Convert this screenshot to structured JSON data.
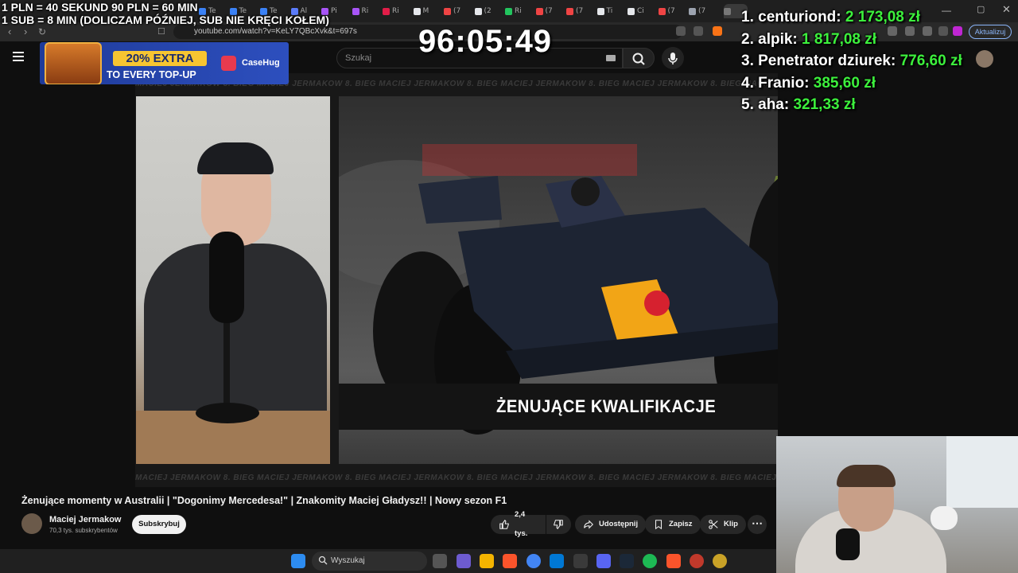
{
  "stream": {
    "donation_line1": "1 PLN = 40 SEKUND 90 PLN = 60 MIN",
    "donation_line2": "1 SUB = 8 MIN (DOLICZAM PÓŹNIEJ, SUB NIE KRĘCI KOŁEM)",
    "timer": "96:05:49",
    "leaderboard": [
      {
        "rank_name": "1. centuriond:",
        "amount": "2 173,08 zł"
      },
      {
        "rank_name": "2. alpik:",
        "amount": "1 817,08 zł"
      },
      {
        "rank_name": "3. Penetrator dziurek:",
        "amount": "776,60 zł"
      },
      {
        "rank_name": "4. Franio:",
        "amount": "385,60 zł"
      },
      {
        "rank_name": "5. aha:",
        "amount": "321,33 zł"
      }
    ]
  },
  "browser": {
    "url": "youtube.com/watch?v=KeLY7QBcXvk&t=697s",
    "update_button": "Aktualizuj",
    "tabs": [
      {
        "label": "Te",
        "color": "#3b82f6"
      },
      {
        "label": "Te",
        "color": "#3b82f6"
      },
      {
        "label": "Te",
        "color": "#3b82f6"
      },
      {
        "label": "Al",
        "color": "#5b7cfa"
      },
      {
        "label": "Pi",
        "color": "#a855f7"
      },
      {
        "label": "Ri",
        "color": "#a855f7"
      },
      {
        "label": "Ri",
        "color": "#e11d48"
      },
      {
        "label": "M",
        "color": "#e5e7eb"
      },
      {
        "label": "(7",
        "color": "#ef4444"
      },
      {
        "label": "(2",
        "color": "#e5e7eb"
      },
      {
        "label": "Ri",
        "color": "#22c55e"
      },
      {
        "label": "(7",
        "color": "#ef4444"
      },
      {
        "label": "(7",
        "color": "#ef4444"
      },
      {
        "label": "Ti",
        "color": "#e5e7eb"
      },
      {
        "label": "Ci",
        "color": "#e5e7eb"
      },
      {
        "label": "(7",
        "color": "#ef4444"
      },
      {
        "label": "(7",
        "color": "#9ca3af"
      }
    ]
  },
  "youtube": {
    "search_placeholder": "Szukaj",
    "video_title": "Żenujące momenty w Australii | \"Dogonimy Mercedesa!\" | Znakomity Maciej Gładysz!! | Nowy sezon F1",
    "channel_name": "Maciej Jermakow",
    "subscriber_count": "70,3 tys. subskrybentów",
    "subscribe_label": "Subskrybuj",
    "like_count": "2,4 tys.",
    "share_label": "Udostępnij",
    "save_label": "Zapisz",
    "clip_label": "Klip",
    "more_label": "⋯"
  },
  "video_frame": {
    "watermark": "MACIEJ JERMAKOW 8. BIEG   MACIEJ JERMAKOW 8. BIEG   MACIEJ JERMAKOW 8. BIEG   MACIEJ JERMAKOW 8. BIEG   MACIEJ JERMAKOW 8. BIEG   MACIEJ JERMAKOW 8. BIEG",
    "caption": "ŻENUJĄCE KWALIFIKACJE"
  },
  "ad": {
    "promo": "20% EXTRA",
    "subtext": "TO EVERY TOP-UP",
    "brand": "CaseHug"
  },
  "taskbar": {
    "search_label": "Wyszukaj"
  },
  "colors": {
    "leaderboard_amount": "#3cf03c",
    "youtube_bg": "#0f0f0f",
    "ad_yellow": "#f7c531",
    "ad_blue": "#2d4fbe"
  }
}
